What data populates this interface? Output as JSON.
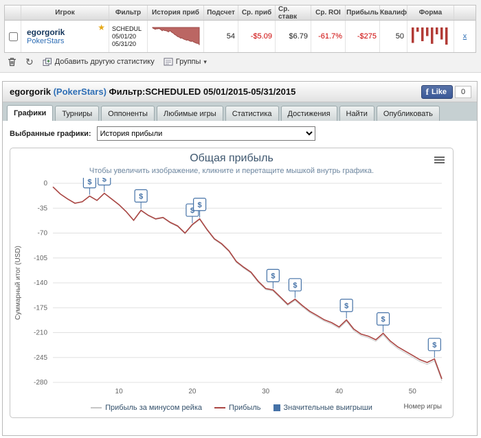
{
  "table": {
    "headers": [
      "Игрок",
      "Фильтр",
      "История приб",
      "Подсчет",
      "Ср. приб",
      "Ср. ставк",
      "Ср. ROI",
      "Прибыль",
      "Квалиф",
      "Форма"
    ],
    "row": {
      "player": "egorgorik",
      "site": "PokerStars",
      "filter_line1": "SCHEDUL",
      "filter_line2": "05/01/20",
      "filter_line3": "05/31/20",
      "count": "54",
      "avg_profit": "-$5.09",
      "avg_stake": "$6.79",
      "avg_roi": "-61.7%",
      "profit": "-$275",
      "qualify": "50",
      "remove_label": "x",
      "form_bars": [
        0.9,
        0.25,
        0.8,
        0.5,
        0.95,
        0.4,
        0.7,
        1.0
      ]
    }
  },
  "toolbar": {
    "add_stat": "Добавить другую статистику",
    "groups": "Группы",
    "groups_caret": "▾"
  },
  "panel": {
    "player": "egorgorik",
    "site": "(PokerStars)",
    "filter": "Фильтр:SCHEDULED 05/01/2015-05/31/2015",
    "fb_like": "Like",
    "fb_f": "f",
    "fb_count": "0"
  },
  "tabs": [
    {
      "label": "Графики",
      "active": true
    },
    {
      "label": "Турниры"
    },
    {
      "label": "Оппоненты"
    },
    {
      "label": "Любимые игры"
    },
    {
      "label": "Статистика"
    },
    {
      "label": "Достижения"
    },
    {
      "label": "Найти"
    },
    {
      "label": "Опубликовать"
    }
  ],
  "chart_controls": {
    "label": "Выбранные графики:",
    "selected": "История прибыли"
  },
  "chart_data": {
    "type": "line",
    "title": "Общая прибыль",
    "subtitle": "Чтобы увеличить изображение, кликните и перетащите мышкой внутрь графика.",
    "ylabel": "Суммарный итог (USD)",
    "xlabel": "Номер игры",
    "ylim": [
      -280,
      0
    ],
    "xlim": [
      1,
      54
    ],
    "yticks": [
      0,
      -35,
      -70,
      -105,
      -140,
      -175,
      -210,
      -245,
      -280
    ],
    "xticks": [
      10,
      20,
      30,
      40,
      50
    ],
    "x": [
      1,
      2,
      3,
      4,
      5,
      6,
      7,
      8,
      9,
      10,
      11,
      12,
      13,
      14,
      15,
      16,
      17,
      18,
      19,
      20,
      21,
      22,
      23,
      24,
      25,
      26,
      27,
      28,
      29,
      30,
      31,
      32,
      33,
      34,
      35,
      36,
      37,
      38,
      39,
      40,
      41,
      42,
      43,
      44,
      45,
      46,
      47,
      48,
      49,
      50,
      51,
      52,
      53,
      54
    ],
    "series": [
      {
        "name": "Прибыль за минусом рейка",
        "color": "#C6C6C6",
        "values": [
          -5.1,
          -15.1,
          -22.2,
          -28.2,
          -26.3,
          -18.3,
          -24.4,
          -14.4,
          -22.5,
          -30.5,
          -40.6,
          -52.6,
          -38.7,
          -45.7,
          -50.8,
          -48.8,
          -55.9,
          -60.9,
          -71,
          -59,
          -51.1,
          -66.1,
          -79.2,
          -86.2,
          -96.3,
          -111.3,
          -119.4,
          -126.4,
          -139.5,
          -149.5,
          -151.6,
          -161.6,
          -171.7,
          -164.7,
          -173.8,
          -181.8,
          -187.9,
          -193.9,
          -198,
          -204,
          -194.1,
          -207.1,
          -214.2,
          -217.2,
          -222.3,
          -213.3,
          -224.4,
          -232.4,
          -238.5,
          -244.5,
          -250.6,
          -254.6,
          -249.7,
          -277.7
        ]
      },
      {
        "name": "Прибыль",
        "color": "#AA4643",
        "values": [
          -5,
          -15,
          -22,
          -28,
          -26,
          -18,
          -24,
          -14,
          -22,
          -30,
          -40,
          -52,
          -38,
          -45,
          -50,
          -48,
          -55,
          -60,
          -70,
          -58,
          -50,
          -65,
          -78,
          -85,
          -95,
          -110,
          -118,
          -125,
          -138,
          -148,
          -150,
          -160,
          -170,
          -163,
          -172,
          -180,
          -186,
          -192,
          -196,
          -202,
          -192,
          -205,
          -212,
          -215,
          -220,
          -211,
          -222,
          -230,
          -236,
          -242,
          -248,
          -252,
          -247,
          -275
        ]
      }
    ],
    "flags": {
      "name": "Значительные выигрыши",
      "color": "#4572A7",
      "symbol": "$",
      "games": [
        6,
        8,
        13,
        20,
        21,
        31,
        34,
        41,
        46,
        53
      ]
    },
    "grid": true,
    "legend_position": "bottom-center"
  }
}
